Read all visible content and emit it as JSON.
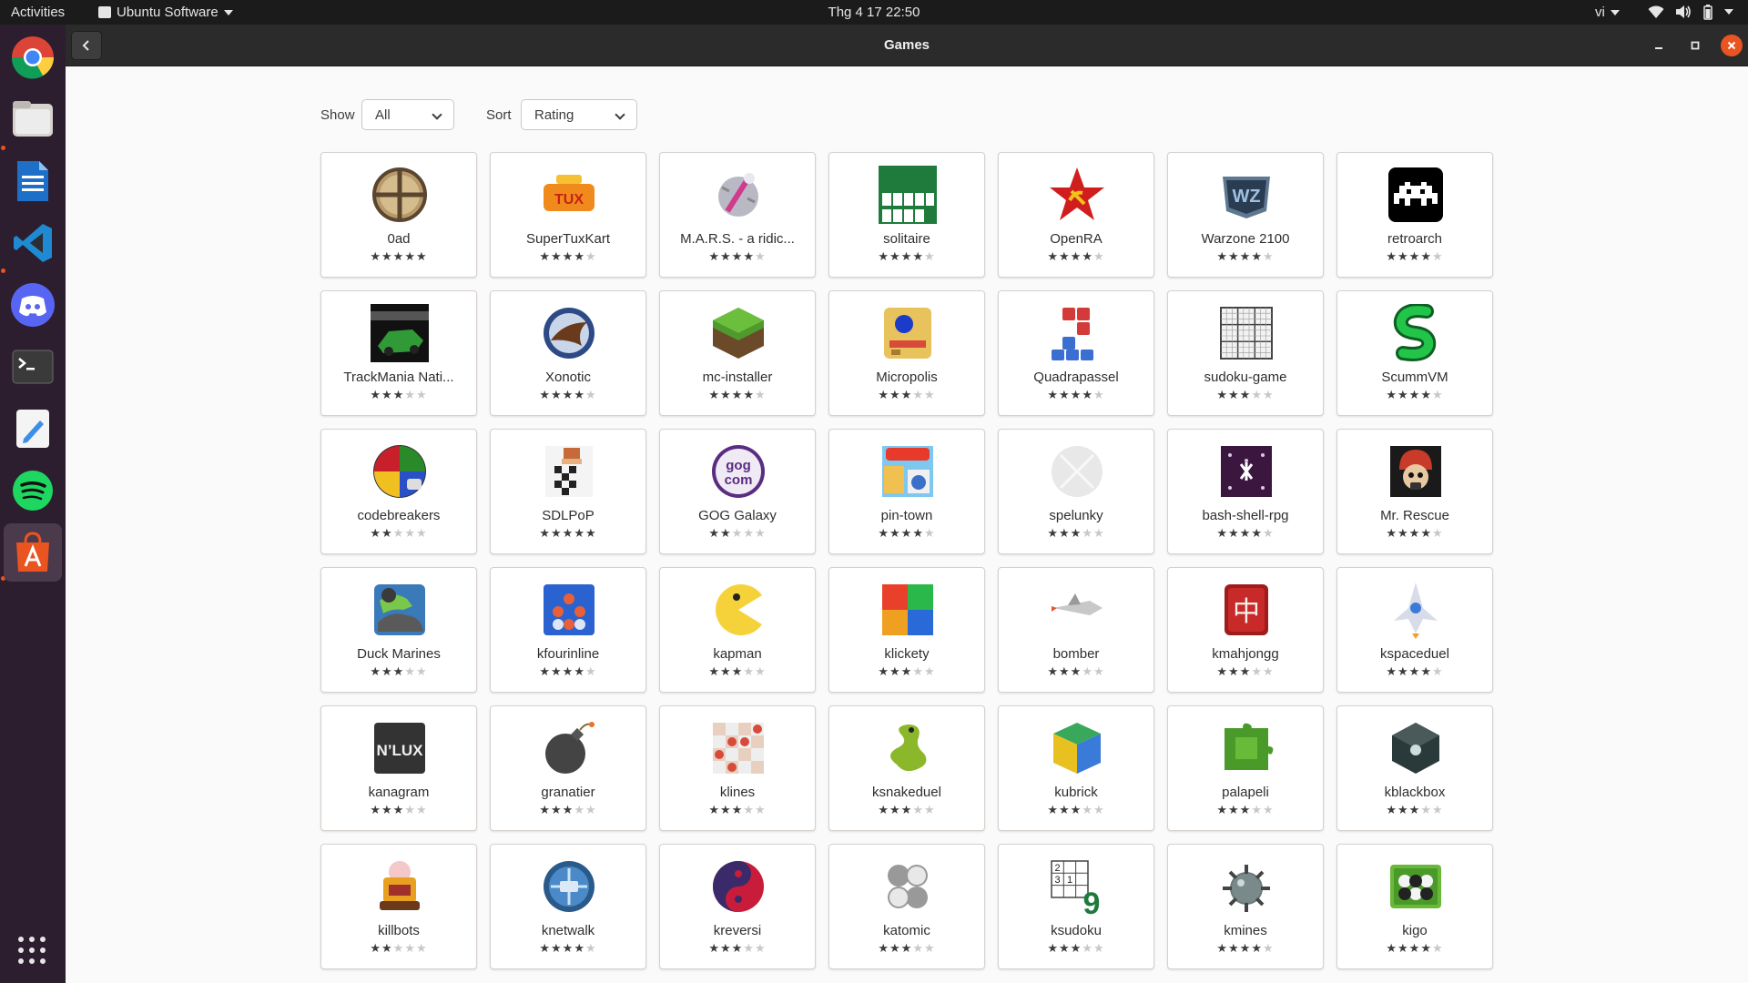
{
  "topbar": {
    "activities": "Activities",
    "app_name": "Ubuntu Software",
    "clock": "Thg 4 17  22:50",
    "lang": "vi"
  },
  "dock": {
    "items": [
      {
        "name": "chrome-icon",
        "color": "#db4437"
      },
      {
        "name": "files-icon",
        "color": "#8f8f8f"
      },
      {
        "name": "libreoffice-writer-icon",
        "color": "#1e6fc8"
      },
      {
        "name": "vscode-icon",
        "color": "#1f8ad2"
      },
      {
        "name": "discord-icon",
        "color": "#5865f2"
      },
      {
        "name": "terminal-icon",
        "color": "#3a3a3a"
      },
      {
        "name": "text-editor-icon",
        "color": "#3d8ee8"
      },
      {
        "name": "spotify-icon",
        "color": "#1ed760"
      },
      {
        "name": "ubuntu-software-icon",
        "color": "#e95420"
      }
    ],
    "show_apps": "show-apps-grid-icon"
  },
  "window": {
    "title": "Games"
  },
  "filters": {
    "show_label": "Show",
    "show_value": "All",
    "sort_label": "Sort",
    "sort_value": "Rating"
  },
  "colors": {
    "accent": "#e95420",
    "dock_bg": "#2c1e2e",
    "header_bg": "#2b2b2b",
    "close_button": "#e95420"
  },
  "apps": [
    {
      "name": "0ad",
      "rating": 5,
      "icon": "0ad-icon"
    },
    {
      "name": "SuperTuxKart",
      "rating": 4,
      "icon": "supertuxkart-icon"
    },
    {
      "name": "M.A.R.S. - a ridic...",
      "rating": 4,
      "icon": "mars-icon"
    },
    {
      "name": "solitaire",
      "rating": 4,
      "icon": "solitaire-icon"
    },
    {
      "name": "OpenRA",
      "rating": 4,
      "icon": "openra-icon"
    },
    {
      "name": "Warzone 2100",
      "rating": 4,
      "icon": "warzone-icon"
    },
    {
      "name": "retroarch",
      "rating": 4,
      "icon": "retroarch-icon"
    },
    {
      "name": "TrackMania Nati...",
      "rating": 3,
      "icon": "trackmania-icon"
    },
    {
      "name": "Xonotic",
      "rating": 4,
      "icon": "xonotic-icon"
    },
    {
      "name": "mc-installer",
      "rating": 4,
      "icon": "minecraft-icon"
    },
    {
      "name": "Micropolis",
      "rating": 3,
      "icon": "micropolis-icon"
    },
    {
      "name": "Quadrapassel",
      "rating": 4,
      "icon": "quadrapassel-icon"
    },
    {
      "name": "sudoku-game",
      "rating": 3,
      "icon": "sudoku-icon"
    },
    {
      "name": "ScummVM",
      "rating": 4,
      "icon": "scummvm-icon"
    },
    {
      "name": "codebreakers",
      "rating": 2,
      "icon": "codebreakers-icon"
    },
    {
      "name": "SDLPoP",
      "rating": 5,
      "icon": "sdlpop-icon"
    },
    {
      "name": "GOG Galaxy",
      "rating": 2,
      "icon": "gog-icon"
    },
    {
      "name": "pin-town",
      "rating": 4,
      "icon": "pin-town-icon"
    },
    {
      "name": "spelunky",
      "rating": 3,
      "icon": "spelunky-icon"
    },
    {
      "name": "bash-shell-rpg",
      "rating": 4,
      "icon": "bash-shell-rpg-icon"
    },
    {
      "name": "Mr. Rescue",
      "rating": 4,
      "icon": "mr-rescue-icon"
    },
    {
      "name": "Duck Marines",
      "rating": 3,
      "icon": "duck-marines-icon"
    },
    {
      "name": "kfourinline",
      "rating": 4,
      "icon": "kfourinline-icon"
    },
    {
      "name": "kapman",
      "rating": 3,
      "icon": "kapman-icon"
    },
    {
      "name": "klickety",
      "rating": 3,
      "icon": "klickety-icon"
    },
    {
      "name": "bomber",
      "rating": 3,
      "icon": "bomber-icon"
    },
    {
      "name": "kmahjongg",
      "rating": 3,
      "icon": "kmahjongg-icon"
    },
    {
      "name": "kspaceduel",
      "rating": 4,
      "icon": "kspaceduel-icon"
    },
    {
      "name": "kanagram",
      "rating": 3,
      "icon": "kanagram-icon"
    },
    {
      "name": "granatier",
      "rating": 3,
      "icon": "granatier-icon"
    },
    {
      "name": "klines",
      "rating": 3,
      "icon": "klines-icon"
    },
    {
      "name": "ksnakeduel",
      "rating": 3,
      "icon": "ksnakeduel-icon"
    },
    {
      "name": "kubrick",
      "rating": 3,
      "icon": "kubrick-icon"
    },
    {
      "name": "palapeli",
      "rating": 3,
      "icon": "palapeli-icon"
    },
    {
      "name": "kblackbox",
      "rating": 3,
      "icon": "kblackbox-icon"
    },
    {
      "name": "killbots",
      "rating": 2,
      "icon": "killbots-icon"
    },
    {
      "name": "knetwalk",
      "rating": 4,
      "icon": "knetwalk-icon"
    },
    {
      "name": "kreversi",
      "rating": 3,
      "icon": "kreversi-icon"
    },
    {
      "name": "katomic",
      "rating": 3,
      "icon": "katomic-icon"
    },
    {
      "name": "ksudoku",
      "rating": 3,
      "icon": "ksudoku-icon"
    },
    {
      "name": "kmines",
      "rating": 4,
      "icon": "kmines-icon"
    },
    {
      "name": "kigo",
      "rating": 4,
      "icon": "kigo-icon"
    }
  ],
  "icon_text": {
    "ksudoku": [
      "2",
      "3",
      "1",
      "9"
    ],
    "gog": [
      "gog",
      "com"
    ],
    "kanagram": "N’LUX",
    "mahjong": "中",
    "warzone": "WZ"
  }
}
